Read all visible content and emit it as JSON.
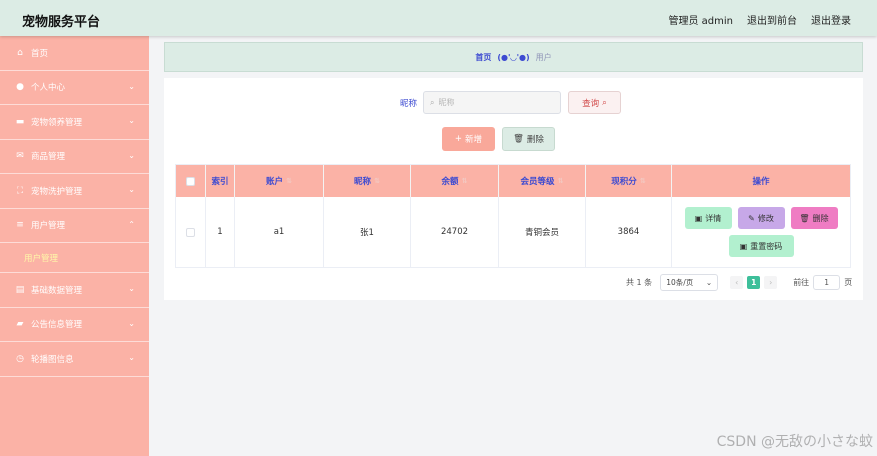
{
  "header": {
    "title": "宠物服务平台",
    "admin_label": "管理员 admin",
    "back_to_front": "退出到前台",
    "logout": "退出登录"
  },
  "sidebar": {
    "items": [
      {
        "label": "首页",
        "icon": "home-icon"
      },
      {
        "label": "个人中心",
        "icon": "user-icon"
      },
      {
        "label": "宠物领养管理",
        "icon": "briefcase-icon"
      },
      {
        "label": "商品管理",
        "icon": "mail-icon"
      },
      {
        "label": "宠物洗护管理",
        "icon": "scan-icon"
      },
      {
        "label": "用户管理",
        "icon": "sliders-icon",
        "sub": "用户管理"
      },
      {
        "label": "基础数据管理",
        "icon": "clipboard-icon"
      },
      {
        "label": "公告信息管理",
        "icon": "ticket-icon"
      },
      {
        "label": "轮播图信息",
        "icon": "clock-icon"
      }
    ]
  },
  "breadcrumb": {
    "home": "首页",
    "face": "(●'◡'●)",
    "current": "用户"
  },
  "search": {
    "label": "昵称",
    "placeholder": "昵称",
    "button": "查询"
  },
  "actions": {
    "add": "新增",
    "delete": "删除"
  },
  "table": {
    "columns": [
      "索引",
      "账户",
      "昵称",
      "余额",
      "会员等级",
      "现积分",
      "操作"
    ],
    "rows": [
      {
        "index": "1",
        "account": "a1",
        "nickname": "张1",
        "balance": "24702",
        "level": "青铜会员",
        "points": "3864"
      }
    ],
    "ops": {
      "detail": "详情",
      "edit": "修改",
      "delete": "删除",
      "reset": "重置密码"
    }
  },
  "pagination": {
    "total": "共 1 条",
    "page_size": "10条/页",
    "current": "1",
    "goto": "前往",
    "goto_value": "1",
    "page_unit": "页"
  },
  "watermark": "CSDN @无敌の小さな蚊",
  "colors": {
    "accent": "#fbb2a6",
    "header_bg": "#dcece5",
    "link_blue": "#3d4bd1",
    "active_sub": "#fff7a8"
  }
}
